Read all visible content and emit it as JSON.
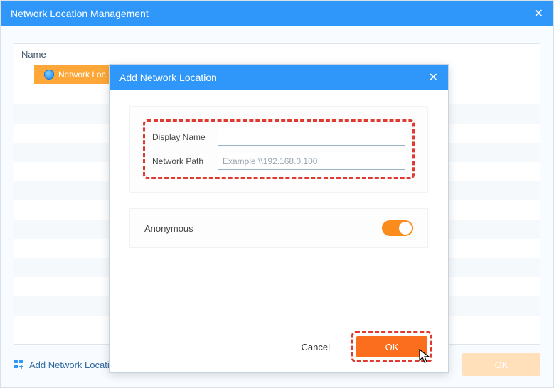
{
  "window": {
    "title": "Network Location Management",
    "close_glyph": "✕"
  },
  "panel": {
    "header_name": "Name",
    "tree_item": "Network Loc"
  },
  "footer": {
    "add_link_label": "Add Network Location",
    "cancel_label": "Cancel",
    "ok_label": "OK"
  },
  "modal": {
    "title": "Add Network Location",
    "close_glyph": "✕",
    "form": {
      "display_name_label": "Display Name",
      "display_name_value": "",
      "network_path_label": "Network Path",
      "network_path_placeholder": "Example:\\\\192.168.0.100",
      "network_path_value": ""
    },
    "anonymous_label": "Anonymous",
    "anonymous_on": true,
    "cancel_label": "Cancel",
    "ok_label": "OK"
  }
}
